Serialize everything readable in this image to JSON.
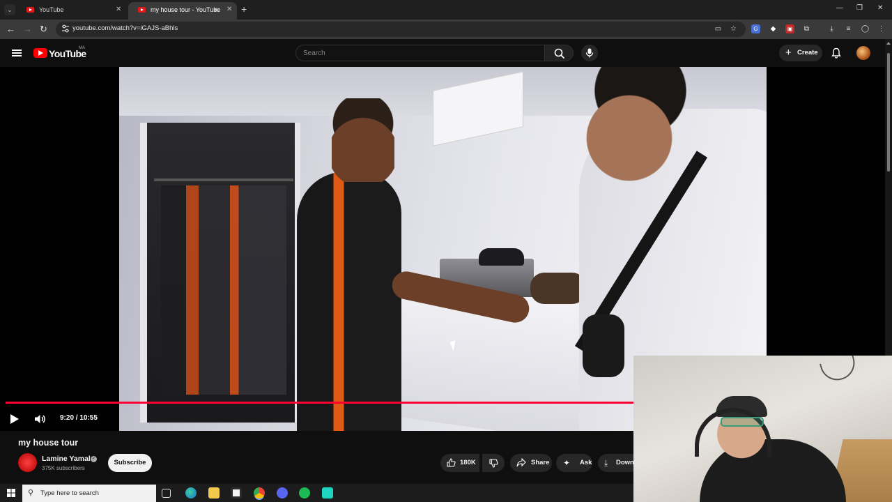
{
  "browser": {
    "tabs": [
      {
        "title": "YouTube",
        "active": false
      },
      {
        "title": "my house tour - YouTube",
        "active": true
      }
    ],
    "url": "youtube.com/watch?v=iGAJS-aBhls"
  },
  "youtube": {
    "logo_text": "YouTube",
    "country_code": "MA",
    "search_placeholder": "Search",
    "create_label": "Create"
  },
  "player": {
    "current_time": "9:20",
    "duration": "10:55",
    "time_display": "9:20 / 10:55",
    "progress": 0.853,
    "progress_color": "#ff0033"
  },
  "video": {
    "title": "my house tour",
    "channel": {
      "name": "Lamine Yamal",
      "subscribers": "375K subscribers",
      "verified": true
    },
    "subscribe_label": "Subscribe",
    "actions": {
      "likes": "180K",
      "share": "Share",
      "ask": "Ask",
      "download": "Down"
    }
  },
  "taskbar": {
    "search_placeholder": "Type here to search"
  },
  "colors": {
    "yt_red": "#ff0000",
    "background": "#0f0f0f",
    "chip": "#272727"
  }
}
